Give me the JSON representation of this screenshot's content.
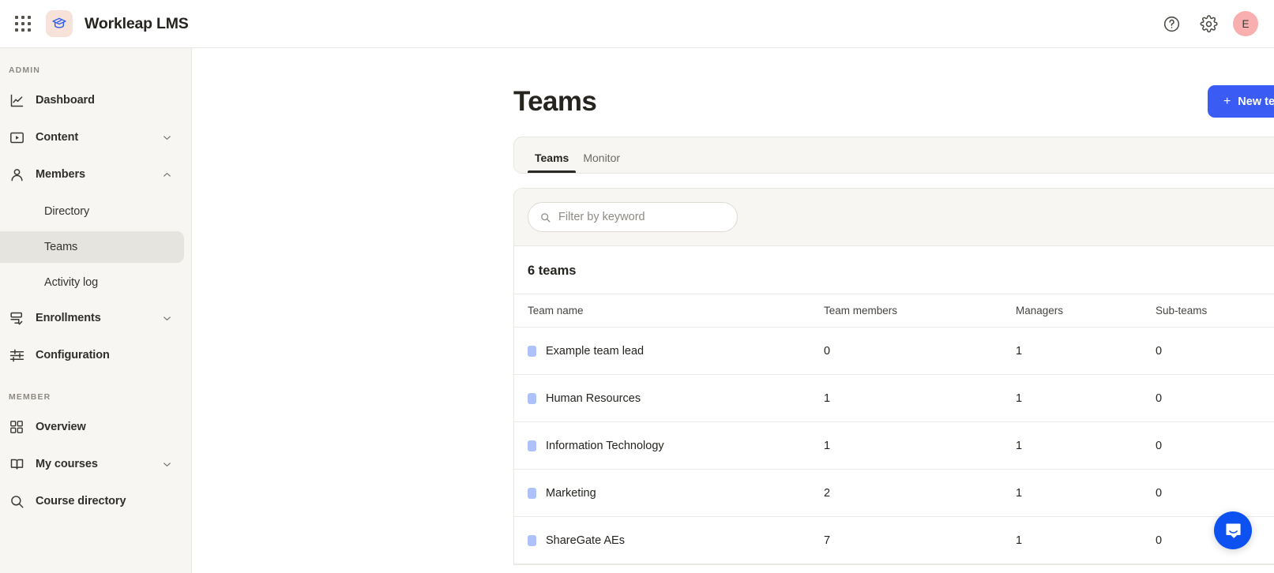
{
  "topbar": {
    "apps_icon": "apps-grid-icon",
    "logo_icon": "graduation-cap-icon",
    "title": "Workleap LMS",
    "help_icon": "help-circle-icon",
    "settings_icon": "gear-icon",
    "avatar_initial": "E"
  },
  "sidebar": {
    "sections": [
      {
        "label": "ADMIN",
        "items": [
          {
            "label": "Dashboard",
            "icon": "chart-line-icon",
            "active": false,
            "sub": false,
            "chevron": ""
          },
          {
            "label": "Content",
            "icon": "video-play-icon",
            "active": false,
            "sub": false,
            "chevron": "down"
          },
          {
            "label": "Members",
            "icon": "user-icon",
            "active": false,
            "sub": false,
            "chevron": "up"
          },
          {
            "label": "Directory",
            "icon": "",
            "active": false,
            "sub": true,
            "chevron": ""
          },
          {
            "label": "Teams",
            "icon": "",
            "active": true,
            "sub": true,
            "chevron": ""
          },
          {
            "label": "Activity log",
            "icon": "",
            "active": false,
            "sub": true,
            "chevron": ""
          },
          {
            "label": "Enrollments",
            "icon": "enrollment-check-icon",
            "active": false,
            "sub": false,
            "chevron": "down"
          },
          {
            "label": "Configuration",
            "icon": "sliders-icon",
            "active": false,
            "sub": false,
            "chevron": ""
          }
        ]
      },
      {
        "label": "MEMBER",
        "items": [
          {
            "label": "Overview",
            "icon": "grid-squares-icon",
            "active": false,
            "sub": false,
            "chevron": ""
          },
          {
            "label": "My courses",
            "icon": "book-open-icon",
            "active": false,
            "sub": false,
            "chevron": "down"
          },
          {
            "label": "Course directory",
            "icon": "search-icon",
            "active": false,
            "sub": false,
            "chevron": ""
          }
        ]
      }
    ]
  },
  "main": {
    "page_title": "Teams",
    "new_team_button": {
      "plus": "+",
      "label": "New team"
    },
    "tabs": [
      {
        "label": "Teams",
        "active": true
      },
      {
        "label": "Monitor",
        "active": false
      }
    ],
    "search": {
      "icon": "search-icon",
      "placeholder": "Filter by keyword",
      "value": ""
    },
    "count_label": "6 teams",
    "table": {
      "columns": [
        "Team name",
        "Team members",
        "Managers",
        "Sub-teams"
      ],
      "rows": [
        {
          "color": "#aec1fb",
          "name": "Example team lead",
          "members": "0",
          "managers": "1",
          "subteams": "0"
        },
        {
          "color": "#aec1fb",
          "name": "Human Resources",
          "members": "1",
          "managers": "1",
          "subteams": "0"
        },
        {
          "color": "#aec1fb",
          "name": "Information Technology",
          "members": "1",
          "managers": "1",
          "subteams": "0"
        },
        {
          "color": "#aec1fb",
          "name": "Marketing",
          "members": "2",
          "managers": "1",
          "subteams": "0"
        },
        {
          "color": "#aec1fb",
          "name": "ShareGate AEs",
          "members": "7",
          "managers": "1",
          "subteams": "0"
        }
      ]
    }
  },
  "chat": {
    "icon": "intercom-chat-icon"
  },
  "colors": {
    "accent": "#3b5bf5",
    "chat": "#0d52f0",
    "sidebar_bg": "#f7f6f3",
    "sidebar_active": "#e6e4df",
    "avatar": "#f9afaf",
    "logo_bg": "#f7e2da",
    "logo_fg": "#2c5cf0",
    "team_swatch": "#aec1fb"
  }
}
